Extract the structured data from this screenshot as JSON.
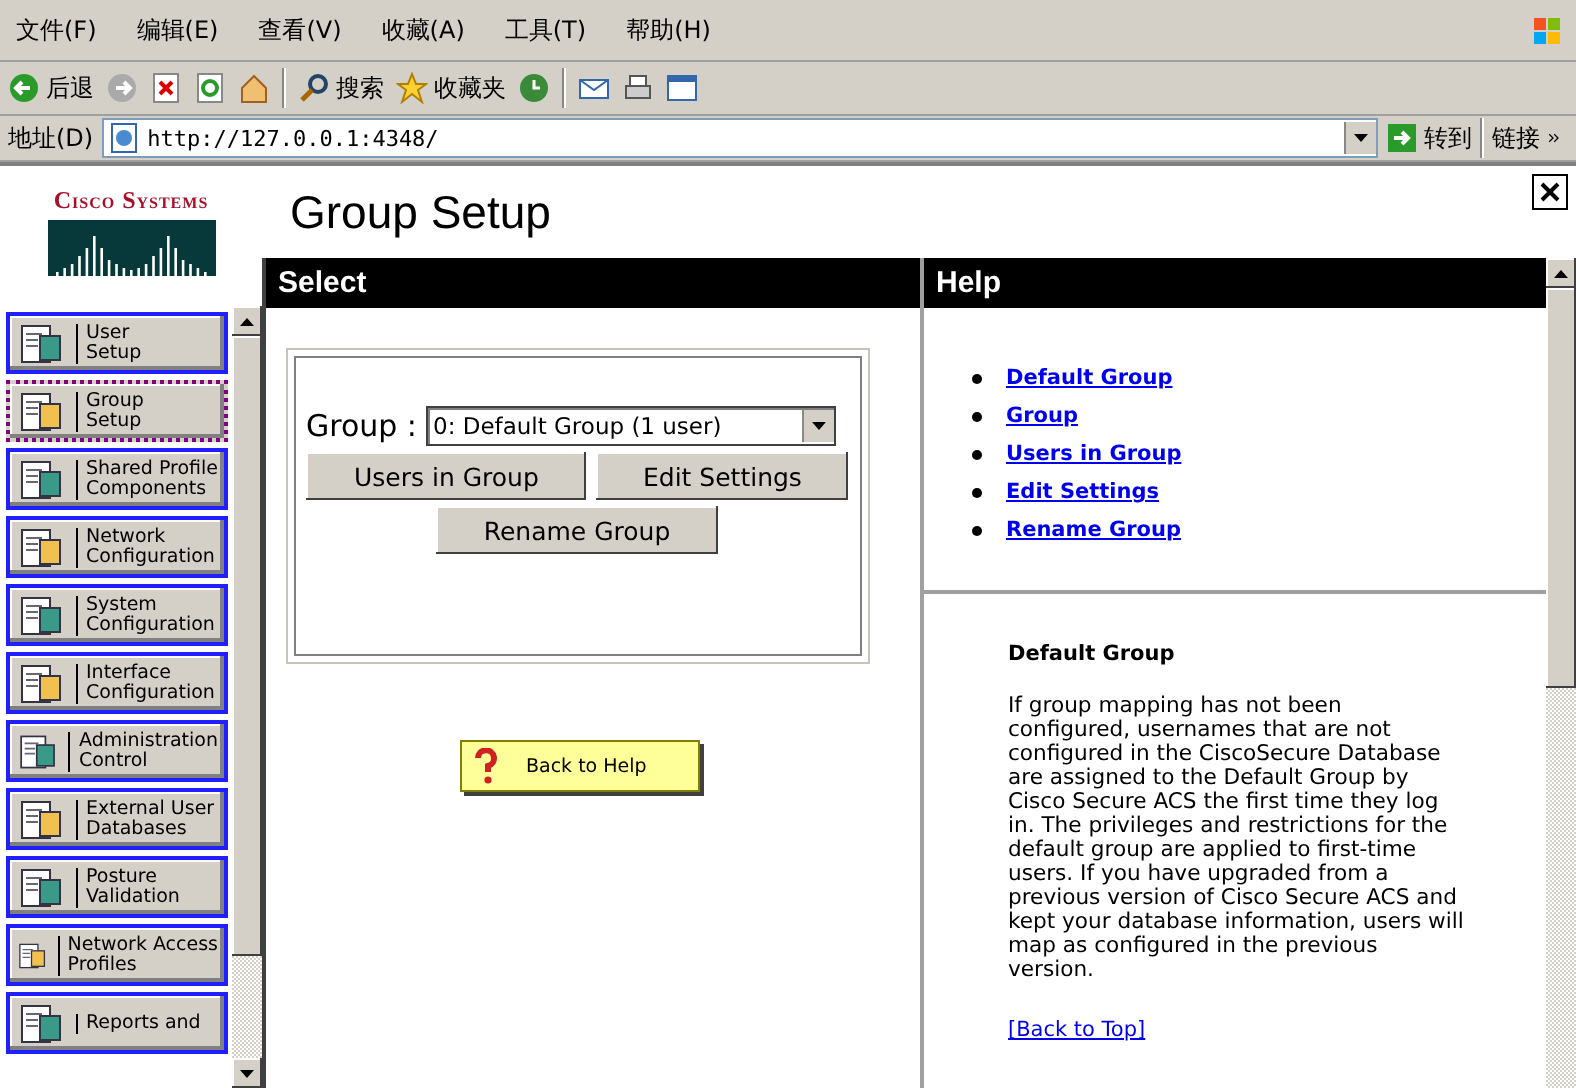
{
  "menu_bar": [
    "文件(F)",
    "编辑(E)",
    "查看(V)",
    "收藏(A)",
    "工具(T)",
    "帮助(H)"
  ],
  "toolbar": {
    "back": "后退",
    "search": "搜索",
    "favorites": "收藏夹"
  },
  "address_bar": {
    "label": "地址(D)",
    "value": "http://127.0.0.1:4348/",
    "go": "转到",
    "links": "链接"
  },
  "logo": "Cisco Systems",
  "page_title": "Group Setup",
  "sidebar": {
    "items": [
      {
        "line1": "User",
        "line2": "Setup",
        "selected": false
      },
      {
        "line1": "Group",
        "line2": "Setup",
        "selected": true
      },
      {
        "line1": "Shared Profile",
        "line2": "Components",
        "selected": false
      },
      {
        "line1": "Network",
        "line2": "Configuration",
        "selected": false
      },
      {
        "line1": "System",
        "line2": "Configuration",
        "selected": false
      },
      {
        "line1": "Interface",
        "line2": "Configuration",
        "selected": false
      },
      {
        "line1": "Administration",
        "line2": "Control",
        "selected": false
      },
      {
        "line1": "External User",
        "line2": "Databases",
        "selected": false
      },
      {
        "line1": "Posture",
        "line2": "Validation",
        "selected": false
      },
      {
        "line1": "Network Access",
        "line2": "Profiles",
        "selected": false
      },
      {
        "line1": "Reports and",
        "selected": false
      }
    ]
  },
  "select_panel": {
    "title": "Select",
    "group_label": "Group :",
    "group_value": "0: Default Group (1 user)",
    "buttons": [
      "Users in Group",
      "Edit Settings",
      "Rename Group"
    ],
    "back_to_help": "Back to Help"
  },
  "help_panel": {
    "title": "Help",
    "links": [
      "Default Group",
      "Group",
      "Users in Group",
      "Edit Settings",
      "Rename Group"
    ],
    "section_title": "Default Group",
    "section_text": "If group mapping has not been configured, usernames that are not configured in the CiscoSecure Database are assigned to the Default Group by Cisco Secure ACS the first time they log in. The privileges and restrictions for the default group are applied to first-time users. If you have upgraded from a previous version of Cisco Secure ACS and kept your database information, users will map as configured in the previous version.",
    "back_to_top": "[Back to Top]"
  }
}
